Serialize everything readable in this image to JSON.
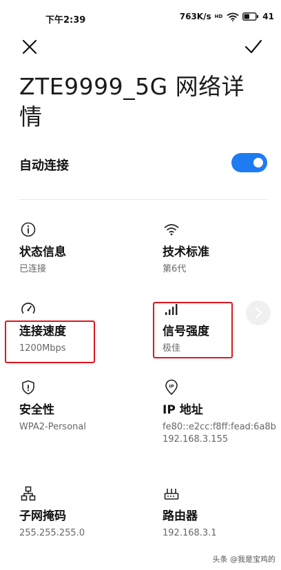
{
  "status_bar": {
    "time": "下午2:39",
    "network_speed": "763K/s",
    "network_tag": "HD",
    "battery": "41"
  },
  "title": "ZTE9999_5G 网络详情",
  "auto_connect": {
    "label": "自动连接",
    "enabled": true,
    "accent_color": "#1f7bf2"
  },
  "details": [
    {
      "icon": "info-icon",
      "title": "状态信息",
      "value": "已连接"
    },
    {
      "icon": "wifi-icon",
      "title": "技术标准",
      "value": "第6代"
    },
    {
      "icon": "speed-gauge-icon",
      "title": "连接速度",
      "value": "1200Mbps"
    },
    {
      "icon": "signal-bars-icon",
      "title": "信号强度",
      "value": "极佳"
    },
    {
      "icon": "shield-icon",
      "title": "安全性",
      "value": "WPA2-Personal"
    },
    {
      "icon": "location-pin-ip-icon",
      "title": "IP 地址",
      "value": "fe80::e2cc:f8ff:fead:6a8b\n192.168.3.155"
    },
    {
      "icon": "network-topology-icon",
      "title": "子网掩码",
      "value": "255.255.255.0"
    },
    {
      "icon": "router-icon",
      "title": "路由器",
      "value": "192.168.3.1"
    }
  ],
  "annotation_color": "#e0141e",
  "watermark": "头条 @我是宝鸡的"
}
